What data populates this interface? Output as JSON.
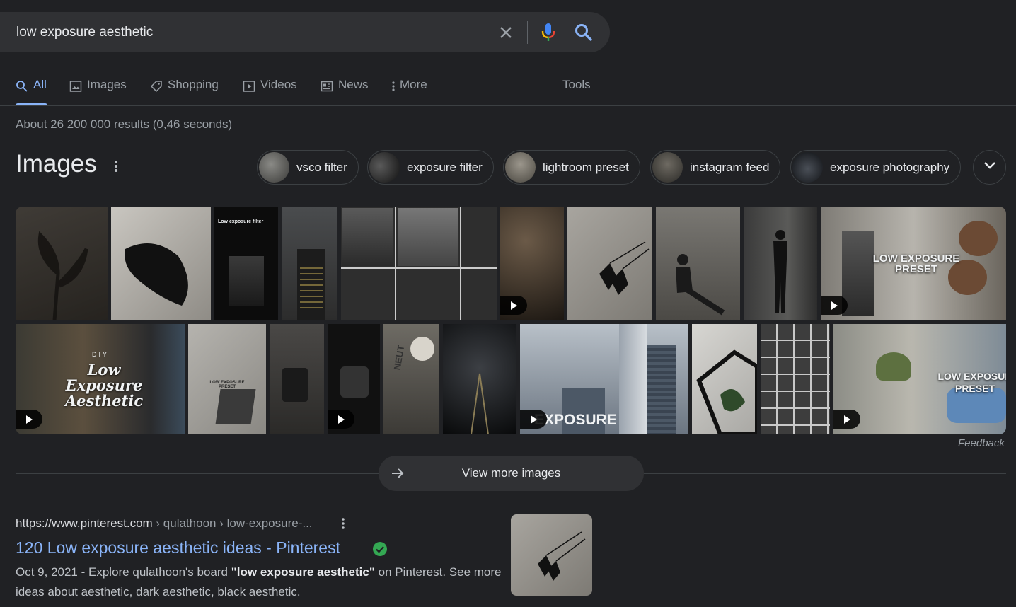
{
  "search": {
    "query": "low exposure aesthetic",
    "icons": [
      "close-icon",
      "microphone-icon",
      "search-icon"
    ]
  },
  "tabs": [
    {
      "label": "All",
      "icon": "search-icon",
      "active": true
    },
    {
      "label": "Images",
      "icon": "image-icon"
    },
    {
      "label": "Shopping",
      "icon": "tag-icon"
    },
    {
      "label": "Videos",
      "icon": "play-icon"
    },
    {
      "label": "News",
      "icon": "newspaper-icon"
    },
    {
      "label": "More",
      "icon": "vertical-dots-icon"
    }
  ],
  "tools_label": "Tools",
  "result_stats": "About 26 200 000 results (0,46 seconds)",
  "images_section": {
    "title": "Images",
    "chips": [
      "vsco filter",
      "exposure filter",
      "lightroom preset",
      "instagram feed",
      "exposure photography"
    ],
    "tile_texts": {
      "low_exposure_filter": "Low exposure filter",
      "preset_1": "LOW EXPOSURE PRESET",
      "diy": "DIY",
      "low_exposure_aesthetic": "Low Exposure Aesthetic",
      "preset_small": "LOW EXPOSURE PRESET",
      "neut": "NEUT",
      "exposure": "EXPOSURE",
      "preset_2": "LOW EXPOSUR PRESET"
    },
    "feedback": "Feedback",
    "view_more": "View more images"
  },
  "result": {
    "url_site": "https://www.pinterest.com",
    "url_path": " › qulathoon › low-exposure-...",
    "title": "120 Low exposure aesthetic ideas - Pinterest",
    "snippet_pre": "Oct 9, 2021 - Explore qulathoon's board ",
    "snippet_bold": "\"low exposure aesthetic\"",
    "snippet_post": " on Pinterest. See more ideas about aesthetic, dark aesthetic, black aesthetic."
  },
  "colors": {
    "background": "#202124",
    "search_bar": "#303134",
    "link": "#8ab4f8",
    "verified": "#34a853"
  }
}
